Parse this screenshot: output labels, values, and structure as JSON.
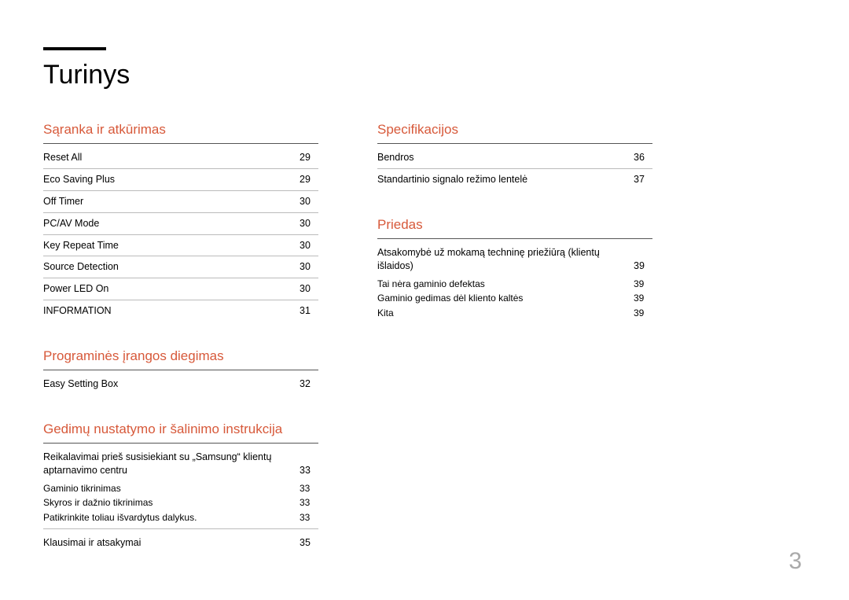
{
  "title": "Turinys",
  "page_number": "3",
  "columns": [
    [
      {
        "heading": "Sąranka ir atkūrimas",
        "entries": [
          {
            "label": "Reset All",
            "page": "29",
            "border": true
          },
          {
            "label": "Eco Saving Plus",
            "page": "29",
            "border": true
          },
          {
            "label": "Off Timer",
            "page": "30",
            "border": true
          },
          {
            "label": "PC/AV Mode",
            "page": "30",
            "border": true
          },
          {
            "label": "Key Repeat Time",
            "page": "30",
            "border": true
          },
          {
            "label": "Source Detection",
            "page": "30",
            "border": true
          },
          {
            "label": "Power LED On",
            "page": "30",
            "border": true
          },
          {
            "label": "INFORMATION",
            "page": "31",
            "border": false
          }
        ]
      },
      {
        "heading": "Programinės įrangos diegimas",
        "entries": [
          {
            "label": "Easy Setting Box",
            "page": "32",
            "border": false
          }
        ]
      },
      {
        "heading": "Gedimų nustatymo ir šalinimo instrukcija",
        "entries": [
          {
            "label": "Reikalavimai prieš susisiekiant su „Samsung“ klientų aptarnavimo centru",
            "page": "33",
            "border": false,
            "subs": [
              {
                "label": "Gaminio tikrinimas",
                "page": "33"
              },
              {
                "label": "Skyros ir dažnio tikrinimas",
                "page": "33"
              },
              {
                "label": "Patikrinkite toliau išvardytus dalykus.",
                "page": "33"
              }
            ],
            "border_after_subs": true
          },
          {
            "label": "Klausimai ir atsakymai",
            "page": "35",
            "border": false
          }
        ]
      }
    ],
    [
      {
        "heading": "Specifikacijos",
        "entries": [
          {
            "label": "Bendros",
            "page": "36",
            "border": true
          },
          {
            "label": "Standartinio signalo režimo lentelė",
            "page": "37",
            "border": false
          }
        ]
      },
      {
        "heading": "Priedas",
        "entries": [
          {
            "label": "Atsakomybė už mokamą techninę priežiūrą (klientų išlaidos)",
            "page": "39",
            "border": false,
            "subs": [
              {
                "label": "Tai nėra gaminio defektas",
                "page": "39"
              },
              {
                "label": "Gaminio gedimas dėl kliento kaltės",
                "page": "39"
              },
              {
                "label": "Kita",
                "page": "39"
              }
            ]
          }
        ]
      }
    ]
  ]
}
